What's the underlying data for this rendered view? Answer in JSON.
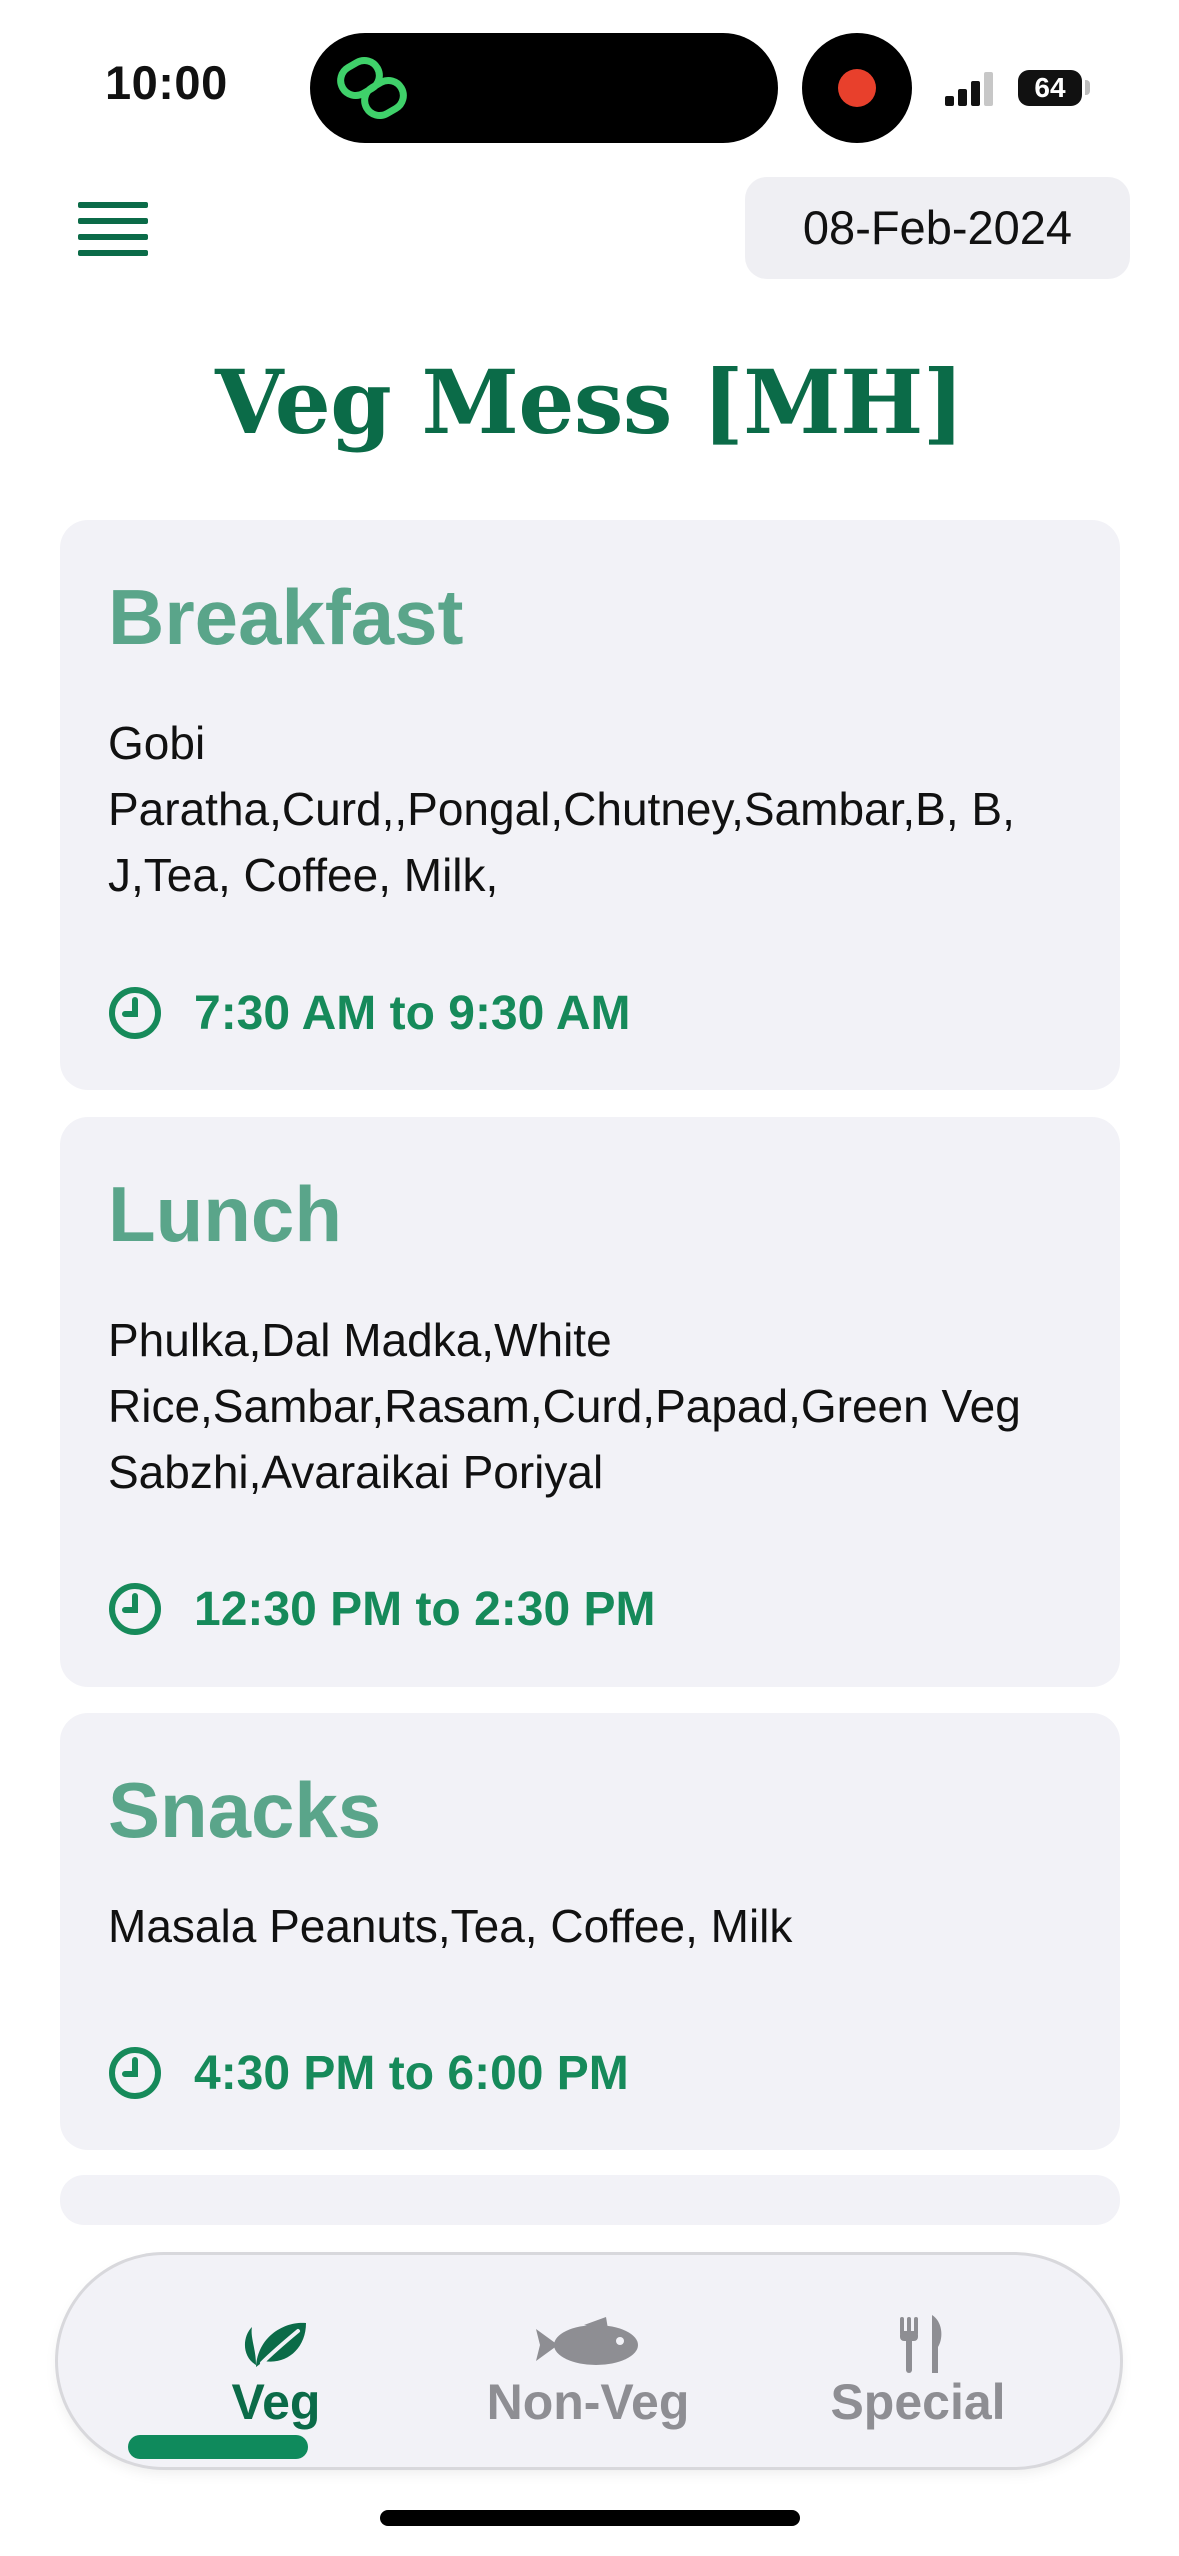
{
  "status_bar": {
    "time": "10:00",
    "battery": "64"
  },
  "header": {
    "date": "08-Feb-2024",
    "title": "Veg Mess [MH]"
  },
  "meals": [
    {
      "name": "Breakfast",
      "items": "Gobi Paratha,Curd,,Pongal,Chutney,Sambar,B, B, J,Tea, Coffee, Milk,",
      "time": "7:30 AM to 9:30 AM"
    },
    {
      "name": "Lunch",
      "items": "Phulka,Dal Madka,White Rice,Sambar,Rasam,Curd,Papad,Green Veg Sabzhi,Avaraikai Poriyal",
      "time": "12:30 PM to 2:30 PM"
    },
    {
      "name": "Snacks",
      "items": "Masala Peanuts,Tea, Coffee, Milk",
      "time": "4:30 PM to 6:00 PM"
    }
  ],
  "tabs": [
    {
      "label": "Veg",
      "icon": "leaf-icon",
      "active": true
    },
    {
      "label": "Non-Veg",
      "icon": "fish-icon",
      "active": false
    },
    {
      "label": "Special",
      "icon": "fork-knife-icon",
      "active": false
    }
  ],
  "colors": {
    "primary": "#0b6b48",
    "meal_title": "#5aa58a",
    "time": "#168a5a",
    "card_bg": "#f2f2f7",
    "inactive": "#8e8e93"
  }
}
